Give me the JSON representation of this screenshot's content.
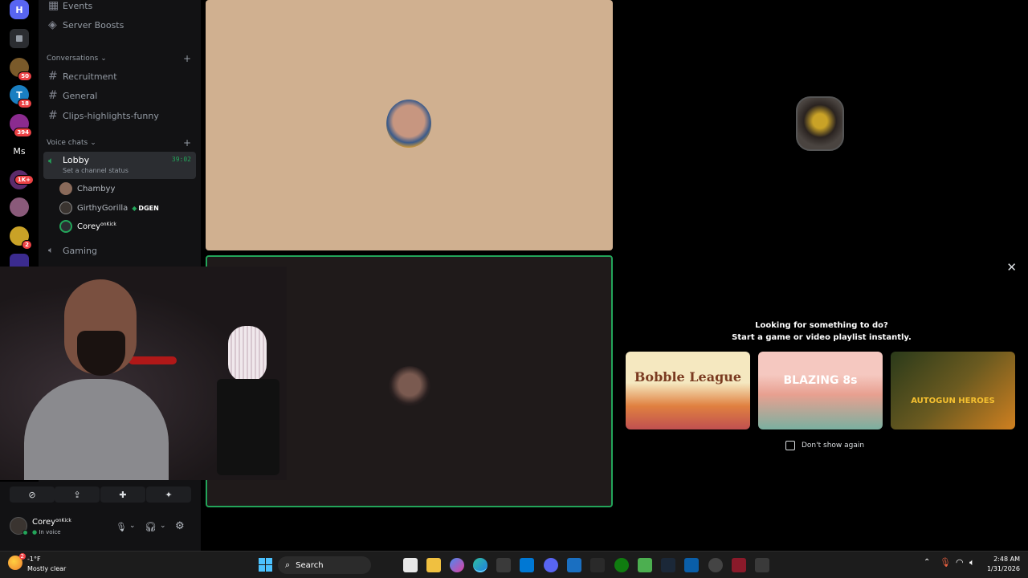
{
  "sidebar": {
    "top_items": [
      "Events",
      "Server Boosts"
    ],
    "conversations_label": "Conversations",
    "text_channels": [
      "Recruitment",
      "General",
      "Clips-highlights-funny"
    ],
    "voice_label": "Voice chats",
    "lobby": {
      "name": "Lobby",
      "timer": "39:02",
      "status_placeholder": "Set a channel status"
    },
    "members": [
      {
        "name": "Chambyy",
        "tag": ""
      },
      {
        "name": "GirthyGorilla",
        "tag": "DGEN"
      },
      {
        "name": "Corey",
        "tag": "onKick"
      }
    ],
    "gaming_channel": "Gaming"
  },
  "servers": [
    {
      "label": "H",
      "color": "#5865f2",
      "badge": ""
    },
    {
      "label": "",
      "color": "#2b2d31",
      "badge": ""
    },
    {
      "label": "",
      "color": "#7a5a2a",
      "badge": "50"
    },
    {
      "label": "T",
      "color": "#1a7fc1",
      "badge": "18"
    },
    {
      "label": "",
      "color": "#8b2b8f",
      "badge": "394"
    },
    {
      "label": "Ms",
      "color": "#000000",
      "badge": ""
    },
    {
      "label": "",
      "color": "#5b2b6b",
      "badge": "1K+"
    },
    {
      "label": "",
      "color": "#8a5a7a",
      "badge": ""
    },
    {
      "label": "",
      "color": "#c9a227",
      "badge": "2"
    },
    {
      "label": "",
      "color": "#3b2b8f",
      "badge": ""
    }
  ],
  "user_panel": {
    "name": "Corey",
    "name_tag": "onKick",
    "status": "In voice"
  },
  "activity": {
    "title_line1": "Looking for something to do?",
    "title_line2": "Start a game or video playlist instantly.",
    "games": [
      "Bobble League",
      "BLAZING 8s",
      "AUTOGUN HEROES"
    ],
    "dont_show": "Don't show again"
  },
  "taskbar": {
    "weather_temp": "-1°F",
    "weather_desc": "Mostly clear",
    "weather_badge": "2",
    "search_label": "Search",
    "time": "2:48 AM",
    "date": "1/31/2026"
  },
  "colors": {
    "speaking_green": "#23a55a",
    "tile_peach": "#d0b090",
    "stage_dark": "#1f1a1a",
    "discord_blurple": "#5865f2"
  }
}
